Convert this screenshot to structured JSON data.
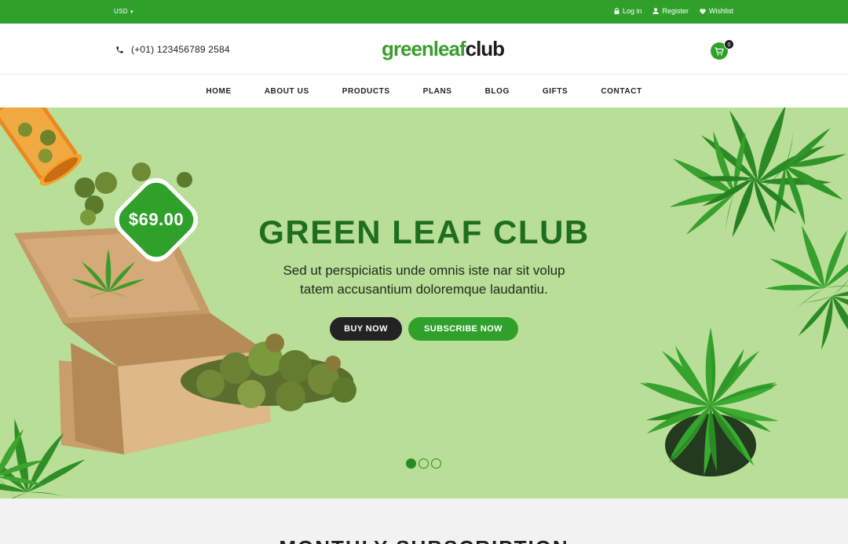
{
  "topbar": {
    "currency": "USD",
    "links": [
      {
        "label": "Log in",
        "icon": "lock-icon"
      },
      {
        "label": "Register",
        "icon": "user-icon"
      },
      {
        "label": "Wishlist",
        "icon": "heart-icon"
      }
    ]
  },
  "header": {
    "phone": "(+01) 123456789 2584",
    "logo_part1": "greenleaf",
    "logo_part2": "club",
    "cart_count": "0"
  },
  "nav": {
    "items": [
      "HOME",
      "ABOUT US",
      "PRODUCTS",
      "PLANS",
      "BLOG",
      "GIFTS",
      "CONTACT"
    ]
  },
  "hero": {
    "price": "$69.00",
    "title": "GREEN LEAF CLUB",
    "subtitle_line1": "Sed ut perspiciatis unde omnis iste nar sit volup",
    "subtitle_line2": "tatem accusantium doloremque laudantiu.",
    "buy_label": "BUY NOW",
    "subscribe_label": "SUBSCRIBE NOW",
    "slide_count": 3,
    "active_slide": 1
  },
  "section": {
    "title": "MONTHLY SUBSCRIPTION"
  },
  "colors": {
    "brand_green": "#2fa12b",
    "hero_bg": "#b9de98",
    "title_green": "#1f6e1f",
    "dark": "#232323"
  }
}
